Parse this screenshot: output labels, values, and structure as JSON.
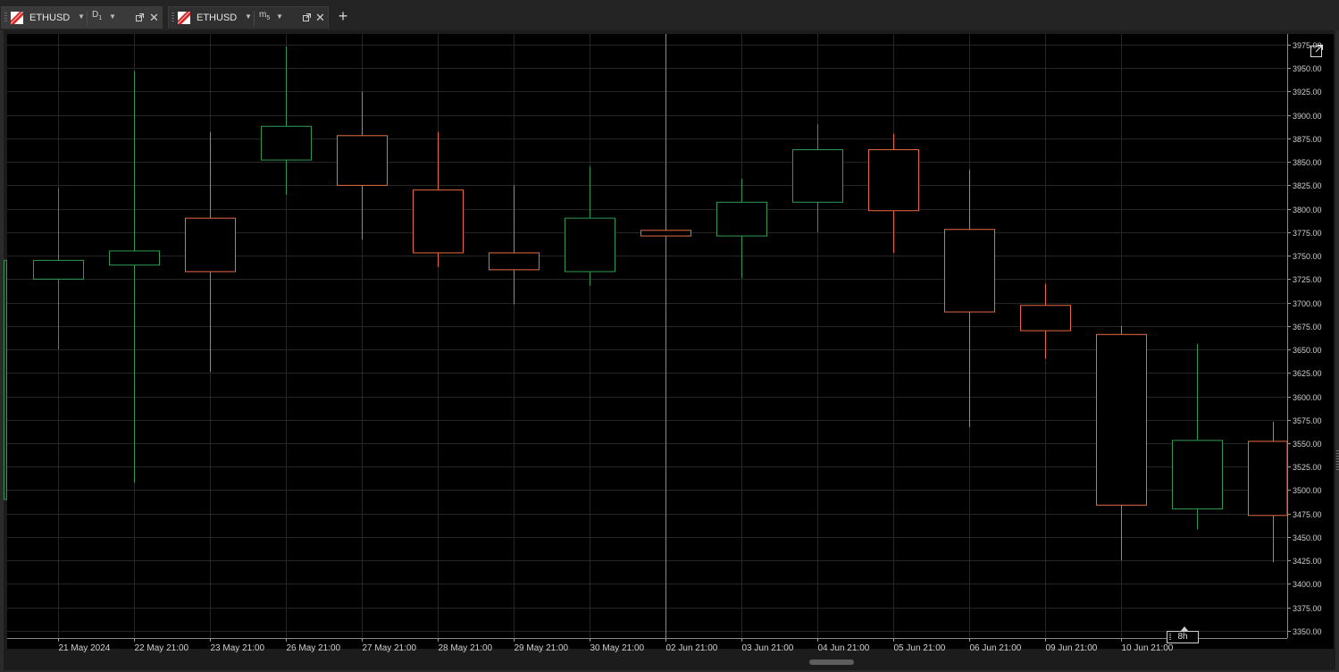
{
  "tabs": [
    {
      "symbol": "ETHUSD",
      "timeframe": "D",
      "timeframe_sub": "1",
      "active": true
    },
    {
      "symbol": "ETHUSD",
      "timeframe": "m",
      "timeframe_sub": "5",
      "active": false
    }
  ],
  "icons": {
    "grip": "grip-icon",
    "symbol": "symbol-flag-icon",
    "dropdown": "chevron-down-icon",
    "popout": "popout-icon",
    "close": "close-icon",
    "add": "plus-icon",
    "expand": "expand-icon"
  },
  "add_tab_label": "+",
  "colors": {
    "background": "#000000",
    "grid": "#262626",
    "bull": "#2f9a50",
    "bear": "#e86a45",
    "axis_text": "#cfcfcf",
    "crosshair": "#8a8a8a"
  },
  "timeframe_marker": "8h",
  "chart_data": {
    "type": "candlestick",
    "y_axis": {
      "min": 3350,
      "max": 3975,
      "step": 25,
      "labels_format": "0.00",
      "position": "right"
    },
    "x_labels": [
      "21 May 2024",
      "22 May 21:00",
      "23 May 21:00",
      "26 May 21:00",
      "27 May 21:00",
      "28 May 21:00",
      "29 May 21:00",
      "30 May 21:00",
      "02 Jun 21:00",
      "03 Jun 21:00",
      "04 Jun 21:00",
      "05 Jun 21:00",
      "06 Jun 21:00",
      "09 Jun 21:00",
      "10 Jun 21:00"
    ],
    "crosshair_x_index": 8,
    "grid": true,
    "candles": [
      {
        "open": 3725,
        "close": 3745,
        "high": 3822,
        "low": 3650
      },
      {
        "open": 3740,
        "close": 3755,
        "high": 3947,
        "low": 3508
      },
      {
        "open": 3790,
        "close": 3733,
        "high": 3882,
        "low": 3626
      },
      {
        "open": 3852,
        "close": 3888,
        "high": 3973,
        "low": 3815
      },
      {
        "open": 3878,
        "close": 3825,
        "high": 3925,
        "low": 3767
      },
      {
        "open": 3820,
        "close": 3753,
        "high": 3882,
        "low": 3738
      },
      {
        "open": 3753,
        "close": 3735,
        "high": 3825,
        "low": 3698
      },
      {
        "open": 3733,
        "close": 3790,
        "high": 3845,
        "low": 3718
      },
      {
        "open": 3777,
        "close": 3771,
        "high": 3852,
        "low": 3770
      },
      {
        "open": 3771,
        "close": 3807,
        "high": 3832,
        "low": 3726
      },
      {
        "open": 3807,
        "close": 3863,
        "high": 3890,
        "low": 3775
      },
      {
        "open": 3863,
        "close": 3798,
        "high": 3880,
        "low": 3753
      },
      {
        "open": 3778,
        "close": 3690,
        "high": 3842,
        "low": 3567
      },
      {
        "open": 3697,
        "close": 3670,
        "high": 3720,
        "low": 3640
      },
      {
        "open": 3666,
        "close": 3484,
        "high": 3675,
        "low": 3425
      },
      {
        "open": 3480,
        "close": 3553,
        "high": 3656,
        "low": 3458
      },
      {
        "open": 3552,
        "close": 3473,
        "high": 3573,
        "low": 3423
      }
    ],
    "partial_left_bar": {
      "open": 3745,
      "close": 3490,
      "color": "bull"
    }
  }
}
